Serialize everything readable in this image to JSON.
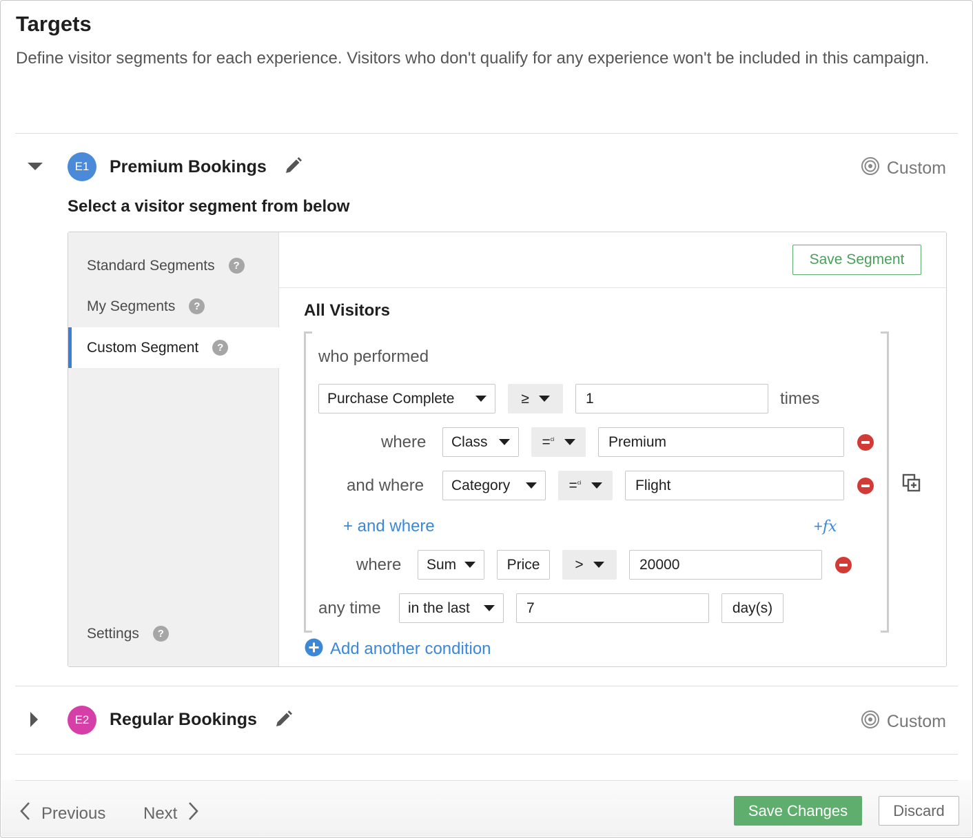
{
  "page": {
    "title": "Targets",
    "description": "Define visitor segments for each experience. Visitors who don't qualify for any experience won't be included in this campaign."
  },
  "experiences": [
    {
      "badge": "E1",
      "badge_color": "#4a8ad8",
      "name": "Premium Bookings",
      "tag": "Custom",
      "expanded": true
    },
    {
      "badge": "E2",
      "badge_color": "#d63fa8",
      "name": "Regular Bookings",
      "tag": "Custom",
      "expanded": false
    }
  ],
  "segment_picker": {
    "heading": "Select a visitor segment from below",
    "sidebar": {
      "items": [
        {
          "label": "Standard Segments",
          "help": "?"
        },
        {
          "label": "My Segments",
          "help": "?"
        },
        {
          "label": "Custom Segment",
          "help": "?",
          "active": true
        }
      ],
      "settings": {
        "label": "Settings",
        "help": "?"
      }
    },
    "save_segment_label": "Save Segment",
    "audience_title": "All Visitors",
    "builder": {
      "who_performed": "who performed",
      "event": "Purchase Complete",
      "count_operator": "≥",
      "count_value": "1",
      "times_label": "times",
      "conditions": [
        {
          "prefix": "where",
          "field": "Class",
          "operator": "=",
          "operator_sup": "ci",
          "value": "Premium"
        },
        {
          "prefix": "and where",
          "field": "Category",
          "operator": "=",
          "operator_sup": "ci",
          "value": "Flight"
        }
      ],
      "add_where_label": "+ and where",
      "fx_plus": "+",
      "fx_label": "fx",
      "aggregate": {
        "prefix": "where",
        "function": "Sum",
        "field": "Price",
        "operator": ">",
        "value": "20000"
      },
      "time": {
        "prefix": "any time",
        "range": "in the last",
        "value": "7",
        "unit": "day(s)"
      }
    },
    "add_condition_label": "Add another condition"
  },
  "footer": {
    "previous_label": "Previous",
    "next_label": "Next",
    "save_label": "Save Changes",
    "discard_label": "Discard"
  },
  "colors": {
    "accent_blue": "#3b88d8",
    "save_green": "#5fae6e",
    "remove_red": "#d23a36"
  }
}
